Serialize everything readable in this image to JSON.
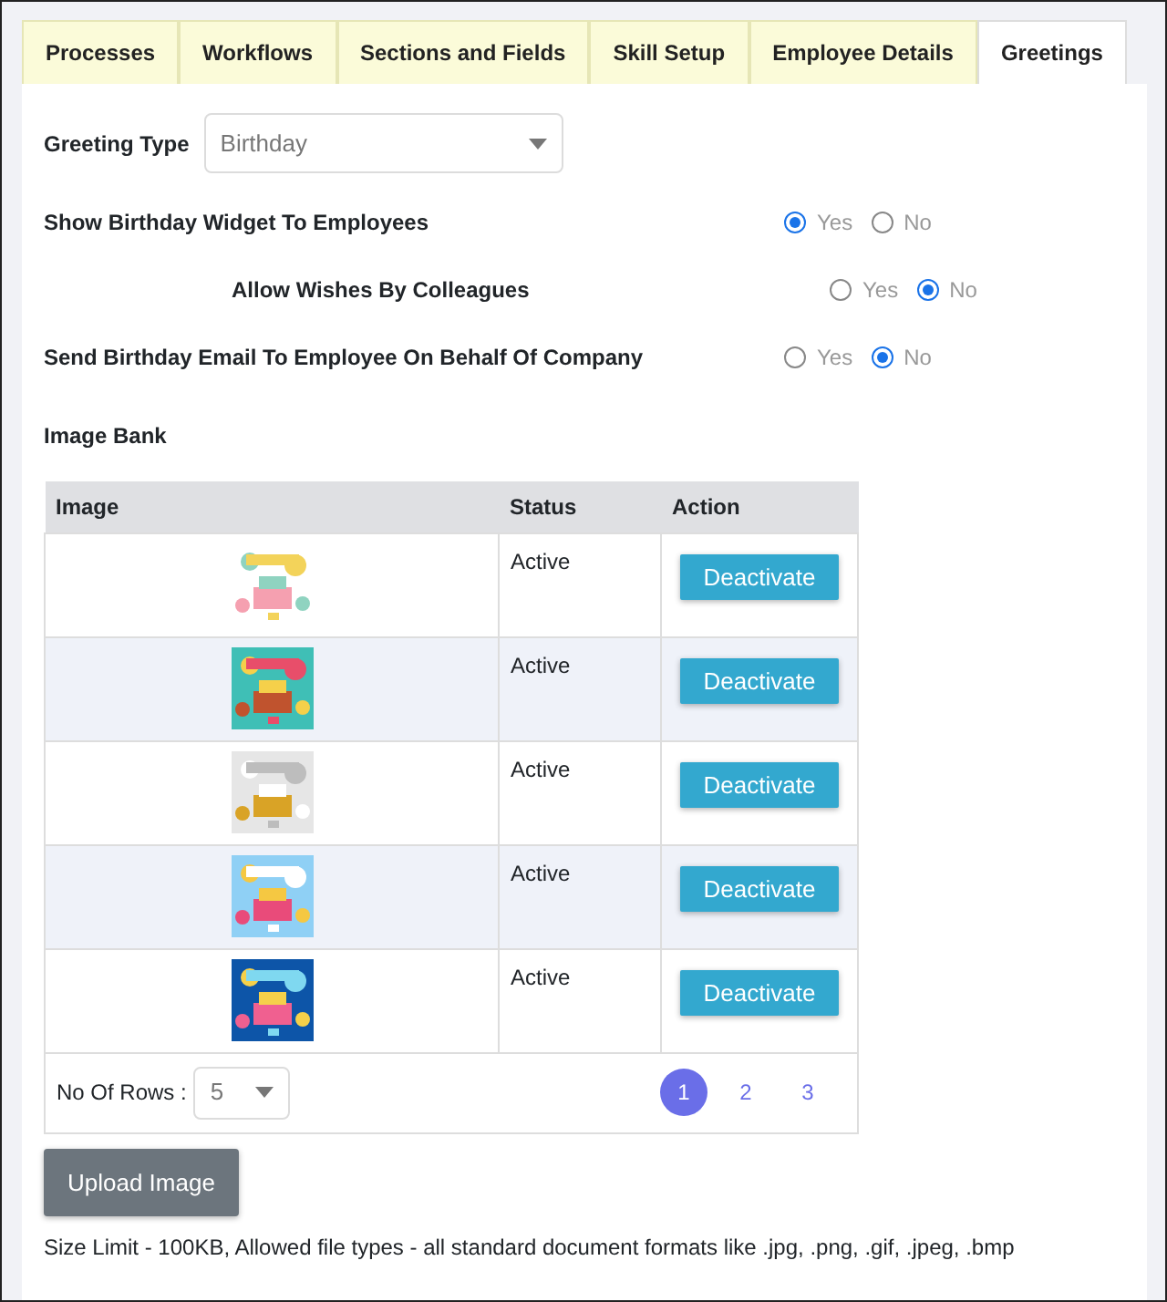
{
  "tabs": [
    {
      "label": "Processes",
      "selected": false
    },
    {
      "label": "Workflows",
      "selected": false
    },
    {
      "label": "Sections and Fields",
      "selected": false
    },
    {
      "label": "Skill Setup",
      "selected": false
    },
    {
      "label": "Employee Details",
      "selected": false
    },
    {
      "label": "Greetings",
      "selected": true
    }
  ],
  "greeting_type": {
    "label": "Greeting Type",
    "value": "Birthday"
  },
  "settings": [
    {
      "kind": "plain",
      "label": "Show Birthday Widget To Employees",
      "options": [
        {
          "label": "Yes",
          "selected": true
        },
        {
          "label": "No",
          "selected": false
        }
      ]
    },
    {
      "kind": "indented",
      "label": "Allow Wishes By Colleagues",
      "options": [
        {
          "label": "Yes",
          "selected": false
        },
        {
          "label": "No",
          "selected": true
        }
      ]
    },
    {
      "kind": "plain",
      "label": "Send Birthday Email To Employee On Behalf Of Company",
      "options": [
        {
          "label": "Yes",
          "selected": false
        },
        {
          "label": "No",
          "selected": true
        }
      ]
    }
  ],
  "image_bank": {
    "title": "Image Bank",
    "columns": [
      "Image",
      "Status",
      "Action"
    ],
    "rows": [
      {
        "status": "Active",
        "action": "Deactivate"
      },
      {
        "status": "Active",
        "action": "Deactivate"
      },
      {
        "status": "Active",
        "action": "Deactivate"
      },
      {
        "status": "Active",
        "action": "Deactivate"
      },
      {
        "status": "Active",
        "action": "Deactivate"
      }
    ],
    "rows_label": "No Of Rows :",
    "rows_value": "5",
    "pages": [
      {
        "label": "1",
        "selected": true
      },
      {
        "label": "2",
        "selected": false
      },
      {
        "label": "3",
        "selected": false
      }
    ]
  },
  "upload_button": "Upload Image",
  "note": "Size Limit - 100KB, Allowed file types - all standard document formats like .jpg, .png, .gif, .jpeg, .bmp"
}
